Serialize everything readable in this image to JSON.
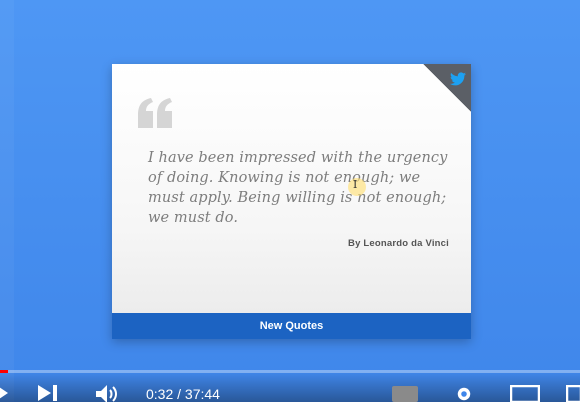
{
  "card": {
    "quote": "I have been impressed with the urgency of doing. Knowing is not enough; we must apply. Being willing is not enough; we must do.",
    "author": "By Leonardo da Vinci",
    "button_label": "New Quotes",
    "icons": {
      "quote_mark": "quote-mark-icon",
      "twitter": "twitter-icon"
    }
  },
  "player": {
    "current_time": "0:32",
    "duration": "37:44",
    "time_text": "0:32 / 37:44",
    "progress_fraction": 0.0141,
    "icons": [
      "play-icon",
      "next-icon",
      "volume-icon",
      "captions-icon",
      "settings-icon",
      "miniplayer-icon",
      "theater-icon"
    ]
  },
  "colors": {
    "background": "#4e97f4",
    "button": "#1c63c2",
    "twitter": "#1da1f2",
    "progress": "#ff0000"
  }
}
